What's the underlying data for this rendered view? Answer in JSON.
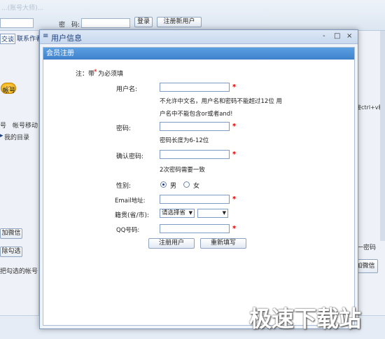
{
  "background": {
    "watermark_top": "...(账号大师)...",
    "password_label": "密　码:",
    "login_button": "登录",
    "register_button": "注册新用户",
    "exchange_tab": "交谈",
    "contacts_tab": "联系作者",
    "account_label": "帐号",
    "tab_label_1": "号",
    "tab_label_2": "帐号移动",
    "tree_item": "我的目录",
    "btn_add_wechat": "加微信",
    "btn_remove_check": "除勾选",
    "btn_move_checked": "把勾选的帐号",
    "right_hint": "接ctrl+v粘",
    "right_pwd": "一密码",
    "right_wechat": "加微信"
  },
  "dialog": {
    "title": "用户信息",
    "minimize": "-",
    "restore": "□",
    "close": "×",
    "panel_title": "会员注册",
    "note_prefix": "注：带",
    "note_star": "*",
    "note_suffix": "为必须填",
    "username_label": "用户名:",
    "username_hint_1": "不允许中文名，用户名和密码不能超过12位 用",
    "username_hint_2": "户名中不能包含or或者and!",
    "password_label": "密码:",
    "password_hint": "密码长度为6-12位",
    "confirm_label": "确认密码:",
    "confirm_hint": "2次密码需要一致",
    "gender_label": "性别:",
    "gender_male": "男",
    "gender_female": "女",
    "email_label": "Email地址:",
    "origin_label": "籍贯(省/市):",
    "province_select": "请选择省",
    "city_select": "",
    "qq_label": "QQ号码:",
    "required_mark": "*",
    "register_button": "注册用户",
    "reset_button": "重新填写"
  },
  "watermark_bottom": "极速下载站"
}
